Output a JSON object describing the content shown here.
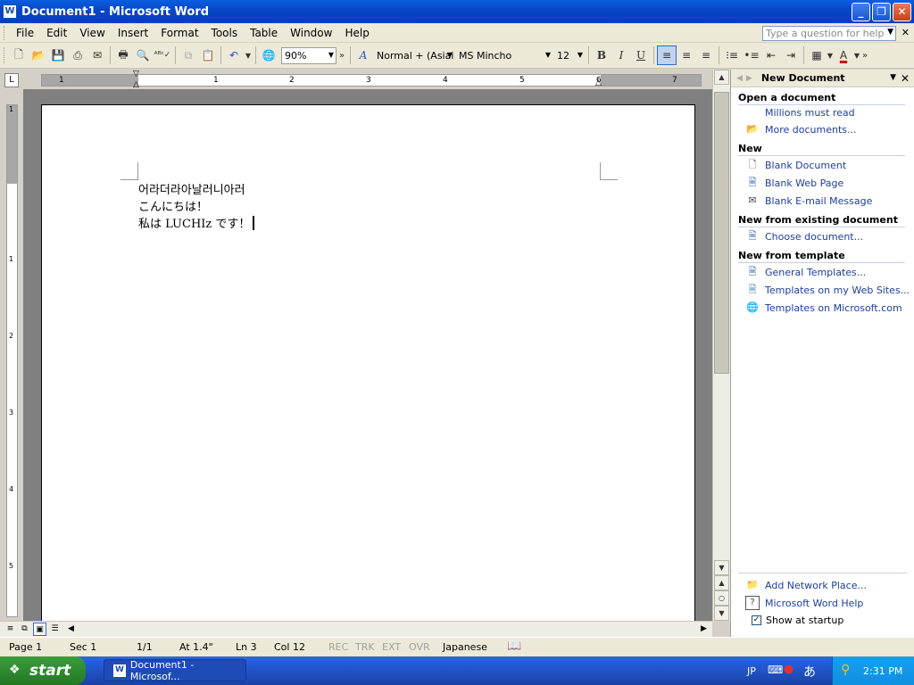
{
  "window": {
    "title": "Document1 - Microsoft Word",
    "app_icon": "W",
    "minimize": "_",
    "restore": "❐",
    "close": "✕"
  },
  "menubar": {
    "items": [
      "File",
      "Edit",
      "View",
      "Insert",
      "Format",
      "Tools",
      "Table",
      "Window",
      "Help"
    ],
    "help_placeholder": "Type a question for help",
    "close_doc": "✕"
  },
  "toolbar": {
    "zoom": "90%",
    "style": "Normal + (Asiai",
    "font": "MS Mincho",
    "size": "12",
    "bold_label": "B",
    "italic_label": "I",
    "underline_label": "U",
    "font_color_label": "A",
    "font_color": "#d00000"
  },
  "ruler": {
    "numbers": [
      "1",
      "1",
      "2",
      "3",
      "4",
      "5",
      "6",
      "7"
    ],
    "vertical_numbers": [
      "1",
      "1",
      "2",
      "3",
      "4",
      "5"
    ]
  },
  "document": {
    "lines": [
      "어라더라아날러니아러",
      "こんにちは！",
      "私は LUCHIz です！"
    ]
  },
  "statusbar": {
    "page": "Page 1",
    "sec": "Sec 1",
    "pages": "1/1",
    "at": "At 1.4\"",
    "ln": "Ln 3",
    "col": "Col 12",
    "rec": "REC",
    "trk": "TRK",
    "ext": "EXT",
    "ovr": "OVR",
    "language": "Japanese"
  },
  "taskpane": {
    "title": "New Document",
    "sections": {
      "open": {
        "heading": "Open a document",
        "recent": "Millions must read",
        "more": "More documents..."
      },
      "new": {
        "heading": "New",
        "blank_document": "Blank Document",
        "blank_web_page": "Blank Web Page",
        "blank_email": "Blank E-mail Message"
      },
      "existing": {
        "heading": "New from existing document",
        "choose": "Choose document..."
      },
      "template": {
        "heading": "New from template",
        "general": "General Templates...",
        "web_sites": "Templates on my Web Sites...",
        "microsoft": "Templates on Microsoft.com"
      }
    },
    "footer": {
      "network_place": "Add Network Place...",
      "help": "Microsoft Word Help",
      "show_startup": "Show at startup"
    }
  },
  "taskbar": {
    "start": "start",
    "task": "Document1 - Microsof...",
    "lang": "JP",
    "ime": "あ",
    "clock": "2:31 PM"
  }
}
